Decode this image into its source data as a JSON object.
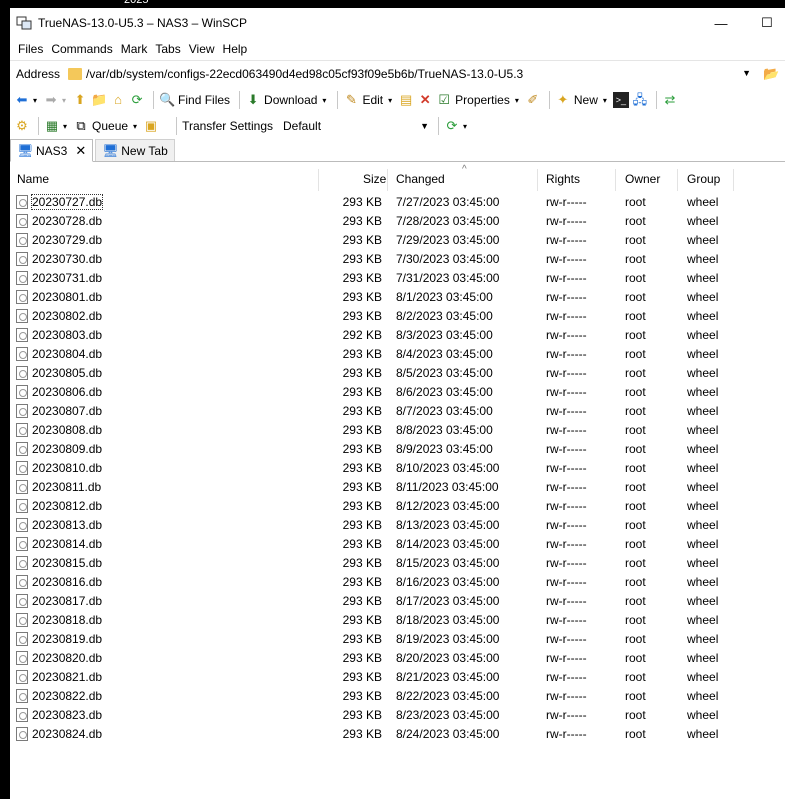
{
  "background": {
    "top_text": "2025"
  },
  "window": {
    "title": "TrueNAS-13.0-U5.3 – NAS3 – WinSCP",
    "minimize_glyph": "—",
    "maximize_glyph": "☐"
  },
  "menu": [
    "Files",
    "Commands",
    "Mark",
    "Tabs",
    "View",
    "Help"
  ],
  "address": {
    "label": "Address",
    "value": "/var/db/system/configs-22ecd063490d4ed98c05cf93f09e5b6b/TrueNAS-13.0-U5.3"
  },
  "toolbar1": {
    "find_files": "Find Files",
    "download": "Download",
    "edit": "Edit",
    "properties": "Properties",
    "new": "New"
  },
  "toolbar2": {
    "queue": "Queue",
    "transfer_settings_label": "Transfer Settings",
    "transfer_settings_value": "Default"
  },
  "tabs": {
    "active": "NAS3",
    "new_tab": "New Tab"
  },
  "columns": {
    "name": "Name",
    "size": "Size",
    "changed": "Changed",
    "rights": "Rights",
    "owner": "Owner",
    "group": "Group"
  },
  "files": [
    {
      "name": "20230727.db",
      "size": "293 KB",
      "changed": "7/27/2023 03:45:00",
      "rights": "rw-r-----",
      "owner": "root",
      "group": "wheel"
    },
    {
      "name": "20230728.db",
      "size": "293 KB",
      "changed": "7/28/2023 03:45:00",
      "rights": "rw-r-----",
      "owner": "root",
      "group": "wheel"
    },
    {
      "name": "20230729.db",
      "size": "293 KB",
      "changed": "7/29/2023 03:45:00",
      "rights": "rw-r-----",
      "owner": "root",
      "group": "wheel"
    },
    {
      "name": "20230730.db",
      "size": "293 KB",
      "changed": "7/30/2023 03:45:00",
      "rights": "rw-r-----",
      "owner": "root",
      "group": "wheel"
    },
    {
      "name": "20230731.db",
      "size": "293 KB",
      "changed": "7/31/2023 03:45:00",
      "rights": "rw-r-----",
      "owner": "root",
      "group": "wheel"
    },
    {
      "name": "20230801.db",
      "size": "293 KB",
      "changed": "8/1/2023 03:45:00",
      "rights": "rw-r-----",
      "owner": "root",
      "group": "wheel"
    },
    {
      "name": "20230802.db",
      "size": "293 KB",
      "changed": "8/2/2023 03:45:00",
      "rights": "rw-r-----",
      "owner": "root",
      "group": "wheel"
    },
    {
      "name": "20230803.db",
      "size": "292 KB",
      "changed": "8/3/2023 03:45:00",
      "rights": "rw-r-----",
      "owner": "root",
      "group": "wheel"
    },
    {
      "name": "20230804.db",
      "size": "293 KB",
      "changed": "8/4/2023 03:45:00",
      "rights": "rw-r-----",
      "owner": "root",
      "group": "wheel"
    },
    {
      "name": "20230805.db",
      "size": "293 KB",
      "changed": "8/5/2023 03:45:00",
      "rights": "rw-r-----",
      "owner": "root",
      "group": "wheel"
    },
    {
      "name": "20230806.db",
      "size": "293 KB",
      "changed": "8/6/2023 03:45:00",
      "rights": "rw-r-----",
      "owner": "root",
      "group": "wheel"
    },
    {
      "name": "20230807.db",
      "size": "293 KB",
      "changed": "8/7/2023 03:45:00",
      "rights": "rw-r-----",
      "owner": "root",
      "group": "wheel"
    },
    {
      "name": "20230808.db",
      "size": "293 KB",
      "changed": "8/8/2023 03:45:00",
      "rights": "rw-r-----",
      "owner": "root",
      "group": "wheel"
    },
    {
      "name": "20230809.db",
      "size": "293 KB",
      "changed": "8/9/2023 03:45:00",
      "rights": "rw-r-----",
      "owner": "root",
      "group": "wheel"
    },
    {
      "name": "20230810.db",
      "size": "293 KB",
      "changed": "8/10/2023 03:45:00",
      "rights": "rw-r-----",
      "owner": "root",
      "group": "wheel"
    },
    {
      "name": "20230811.db",
      "size": "293 KB",
      "changed": "8/11/2023 03:45:00",
      "rights": "rw-r-----",
      "owner": "root",
      "group": "wheel"
    },
    {
      "name": "20230812.db",
      "size": "293 KB",
      "changed": "8/12/2023 03:45:00",
      "rights": "rw-r-----",
      "owner": "root",
      "group": "wheel"
    },
    {
      "name": "20230813.db",
      "size": "293 KB",
      "changed": "8/13/2023 03:45:00",
      "rights": "rw-r-----",
      "owner": "root",
      "group": "wheel"
    },
    {
      "name": "20230814.db",
      "size": "293 KB",
      "changed": "8/14/2023 03:45:00",
      "rights": "rw-r-----",
      "owner": "root",
      "group": "wheel"
    },
    {
      "name": "20230815.db",
      "size": "293 KB",
      "changed": "8/15/2023 03:45:00",
      "rights": "rw-r-----",
      "owner": "root",
      "group": "wheel"
    },
    {
      "name": "20230816.db",
      "size": "293 KB",
      "changed": "8/16/2023 03:45:00",
      "rights": "rw-r-----",
      "owner": "root",
      "group": "wheel"
    },
    {
      "name": "20230817.db",
      "size": "293 KB",
      "changed": "8/17/2023 03:45:00",
      "rights": "rw-r-----",
      "owner": "root",
      "group": "wheel"
    },
    {
      "name": "20230818.db",
      "size": "293 KB",
      "changed": "8/18/2023 03:45:00",
      "rights": "rw-r-----",
      "owner": "root",
      "group": "wheel"
    },
    {
      "name": "20230819.db",
      "size": "293 KB",
      "changed": "8/19/2023 03:45:00",
      "rights": "rw-r-----",
      "owner": "root",
      "group": "wheel"
    },
    {
      "name": "20230820.db",
      "size": "293 KB",
      "changed": "8/20/2023 03:45:00",
      "rights": "rw-r-----",
      "owner": "root",
      "group": "wheel"
    },
    {
      "name": "20230821.db",
      "size": "293 KB",
      "changed": "8/21/2023 03:45:00",
      "rights": "rw-r-----",
      "owner": "root",
      "group": "wheel"
    },
    {
      "name": "20230822.db",
      "size": "293 KB",
      "changed": "8/22/2023 03:45:00",
      "rights": "rw-r-----",
      "owner": "root",
      "group": "wheel"
    },
    {
      "name": "20230823.db",
      "size": "293 KB",
      "changed": "8/23/2023 03:45:00",
      "rights": "rw-r-----",
      "owner": "root",
      "group": "wheel"
    },
    {
      "name": "20230824.db",
      "size": "293 KB",
      "changed": "8/24/2023 03:45:00",
      "rights": "rw-r-----",
      "owner": "root",
      "group": "wheel"
    }
  ]
}
